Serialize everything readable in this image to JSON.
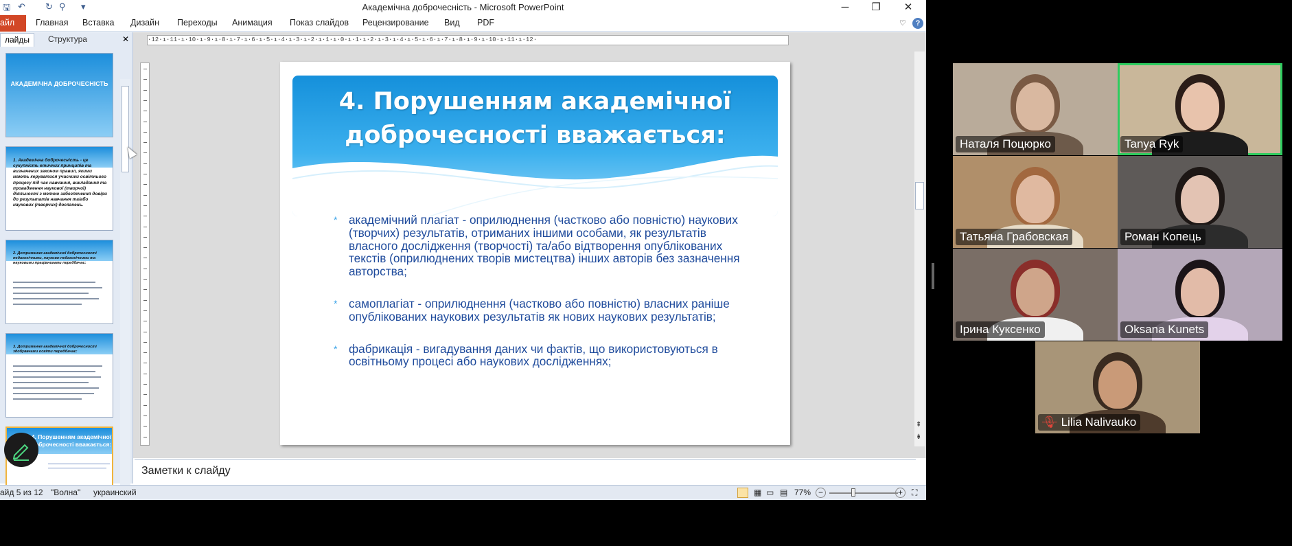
{
  "window": {
    "title": "Академічна доброчесність  -  Microsoft PowerPoint",
    "controls": [
      "─",
      "❐",
      "✕"
    ]
  },
  "ribbon": {
    "file_tab": "айл",
    "tabs": [
      "Главная",
      "Вставка",
      "Дизайн",
      "Переходы",
      "Анимация",
      "Показ слайдов",
      "Рецензирование",
      "Вид",
      "PDF"
    ],
    "help": "?"
  },
  "slides_pane": {
    "tabs": [
      "лайды",
      "Структура"
    ],
    "close": "✕",
    "thumbnails": [
      {
        "title": "АКАДЕМІЧНА ДОБРОЧЕСНІСТЬ",
        "body": ""
      },
      {
        "title": "",
        "body": "1. Академічна доброчесність - це сукупність етичних принципів та визначених законом правил, якими мають керуватися учасники освітнього процесу під час навчання, викладання та провадження наукової (творчої) діяльності з метою забезпечення довіри до результатів навчання та/або наукових (творчих) досягнень."
      },
      {
        "title": "",
        "body": "2. Дотримання академічної доброчесності педагогічними, науково-педагогічними та науковими працівниками передбачає:"
      },
      {
        "title": "",
        "body": "3. Дотримання академічної доброчесності здобувачами освіти передбачає:"
      },
      {
        "title": "4. Порушенням академічної доброчесності вважається:",
        "body": ""
      }
    ]
  },
  "ruler": {
    "horizontal": "·12·ı·11·ı·10·ı·9·ı·8·ı·7·ı·6·ı·5·ı·4·ı·3·ı·2·ı·1·ı·0·ı·1·ı·2·ı·3·ı·4·ı·5·ı·6·ı·7·ı·8·ı·9·ı·10·ı·11·ı·12·"
  },
  "slide": {
    "title_line1": "4. Порушенням академічної",
    "title_line2": "доброчесності вважається:",
    "bullets": [
      "академічний плагіат - оприлюднення (частково або повністю) наукових (творчих) результатів, отриманих іншими особами, як результатів власного дослідження (творчості) та/або відтворення опублікованих текстів (оприлюднених творів мистецтва) інших авторів без зазначення авторства;",
      "самоплагіат - оприлюднення (частково або повністю) власних раніше опублікованих наукових результатів як нових наукових результатів;",
      "фабрикація - вигадування даних чи фактів, що використовуються в освітньому процесі або наукових дослідженнях;"
    ],
    "bullet_marker": "*"
  },
  "notes": {
    "text": "Заметки к слайду"
  },
  "status": {
    "slide_counter": "айд 5 из 12",
    "theme": "\"Волна\"",
    "language": "украинский",
    "zoom": "77%",
    "zoom_out": "−",
    "zoom_in": "+"
  },
  "participants": [
    {
      "name": "Наталя Поцюрко",
      "active": false,
      "muted": false,
      "bg": "#b9ab9a",
      "skin": "#d9b8a0",
      "shirt": "#6d5a4a",
      "hair": "#7a5a44"
    },
    {
      "name": "Tanya Ryk",
      "active": true,
      "muted": false,
      "bg": "#c9b79a",
      "skin": "#e8c3ac",
      "shirt": "#1c1c1c",
      "hair": "#2b1d18"
    },
    {
      "name": "Татьяна Грабовская",
      "active": false,
      "muted": false,
      "bg": "#b08f6a",
      "skin": "#e0b9a0",
      "shirt": "#e7dcc8",
      "hair": "#a2683f"
    },
    {
      "name": "Роман Копець",
      "active": false,
      "muted": false,
      "bg": "#5e5a58",
      "skin": "#e3c3b3",
      "shirt": "#2c2c2c",
      "hair": "#1d1715"
    },
    {
      "name": "Ірина Куксенко",
      "active": false,
      "muted": false,
      "bg": "#7a6e66",
      "skin": "#cfa58a",
      "shirt": "#f0f0f0",
      "hair": "#8a2e2a"
    },
    {
      "name": "Oksana Kunets",
      "active": false,
      "muted": false,
      "bg": "#b4a7b8",
      "skin": "#e2bba8",
      "shirt": "#e3d2ea",
      "hair": "#1b1418"
    },
    {
      "name": "Lilia Nalivauko",
      "active": false,
      "muted": true,
      "bg": "#a89578",
      "skin": "#c99a78",
      "shirt": "#4e3b2c",
      "hair": "#3a2b20"
    }
  ],
  "colors": {
    "accent_green": "#2ecc5f",
    "ppt_orange": "#d24726",
    "slide_text": "#1f4b9c"
  }
}
